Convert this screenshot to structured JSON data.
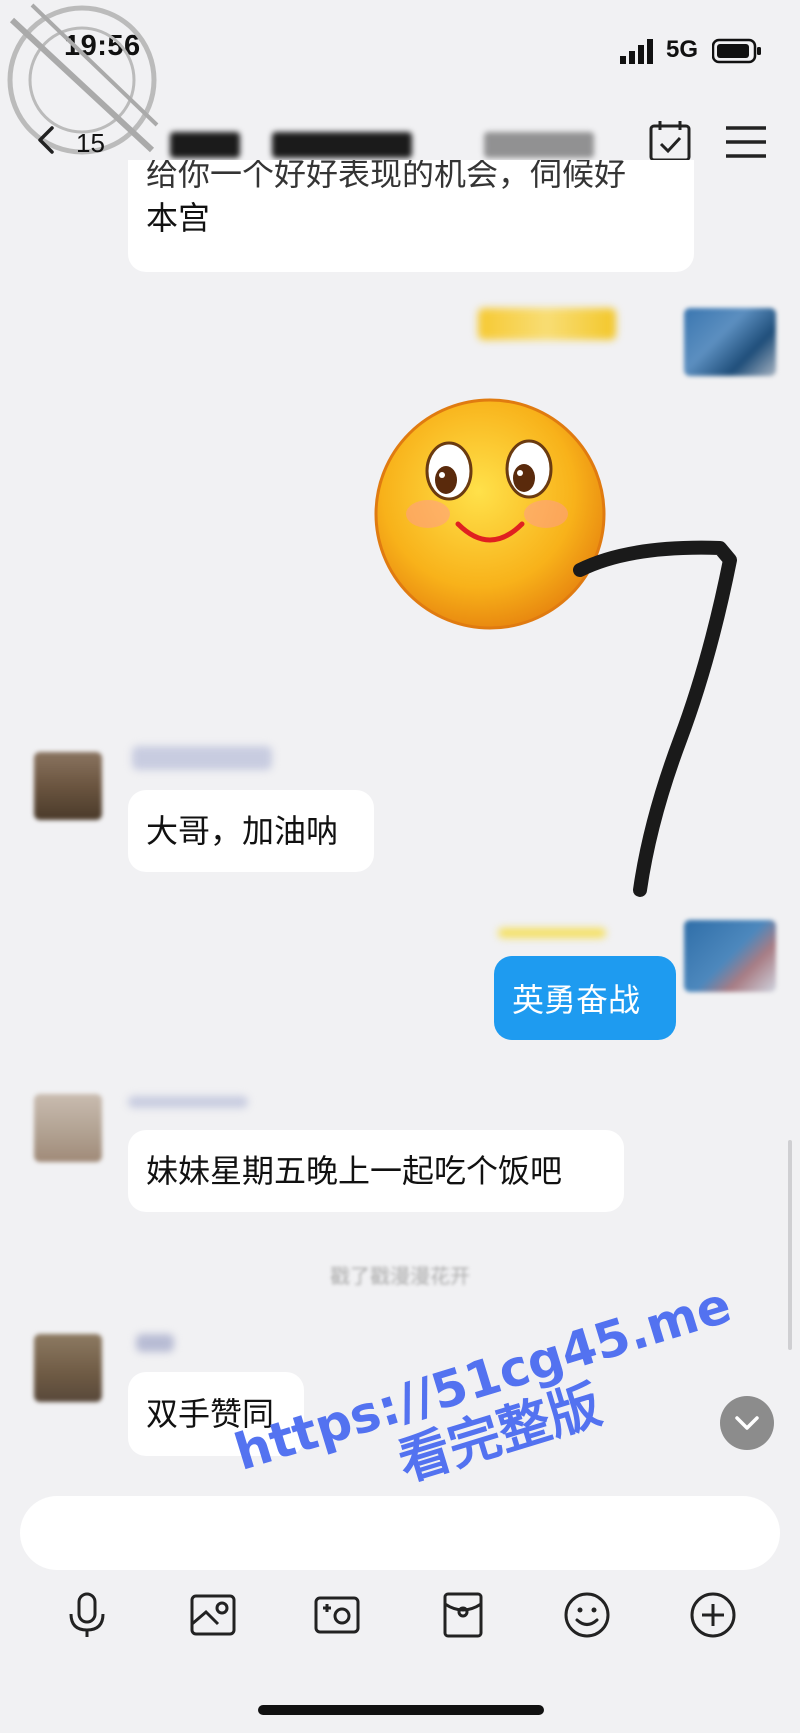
{
  "status_bar": {
    "time": "19:56",
    "network": "5G"
  },
  "nav": {
    "back_count": "15",
    "title": ""
  },
  "messages": [
    {
      "id": "m1",
      "side": "left",
      "text_cut": "给你一个好好表现的机会，伺候好",
      "text": "本宫"
    },
    {
      "id": "m2",
      "side": "right",
      "type": "emoji",
      "emoji": "smile-face"
    },
    {
      "id": "m3",
      "side": "left",
      "text": "大哥，加油呐"
    },
    {
      "id": "m4",
      "side": "right",
      "text": "英勇奋战"
    },
    {
      "id": "m5",
      "side": "left",
      "text": "妹妹星期五晚上一起吃个饭吧"
    },
    {
      "id": "m6",
      "side": "left",
      "text": "双手赞同"
    }
  ],
  "system_notice": "戳了戳漫漫花开",
  "input": {
    "value": "",
    "placeholder": ""
  },
  "toolbar": {
    "icons": [
      "microphone-icon",
      "image-icon",
      "camera-icon",
      "red-packet-icon",
      "emoji-icon",
      "plus-icon"
    ]
  },
  "watermark": {
    "line1": "https://51cg45.me",
    "line2": "看完整版"
  },
  "colors": {
    "background": "#f1f1f3",
    "sent_bubble": "#1e9bf0",
    "watermark": "#4b6cf0"
  }
}
